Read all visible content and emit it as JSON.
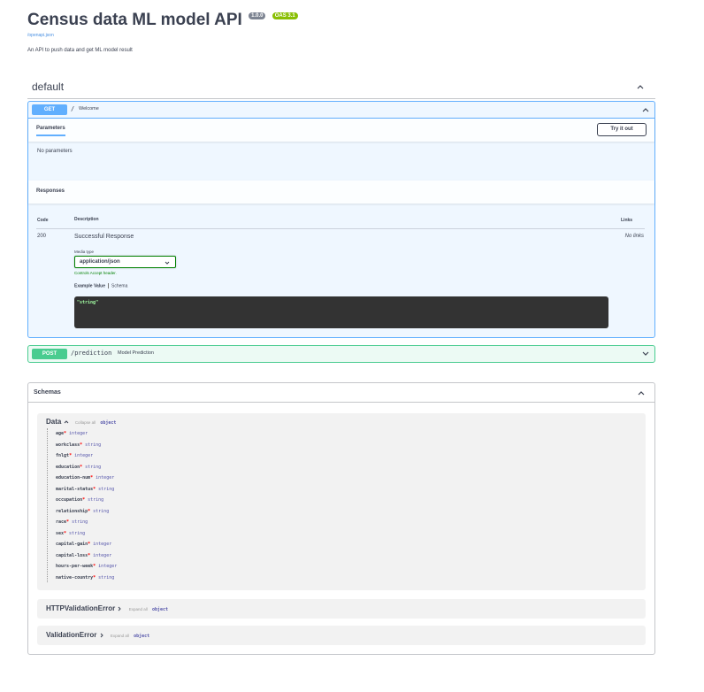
{
  "header": {
    "title": "Census data ML model API",
    "version": "1.0.0",
    "oas": "OAS 3.1",
    "openapi_link": "/openapi.json",
    "description": "An API to push data and get ML model result"
  },
  "tag": {
    "name": "default"
  },
  "get_op": {
    "method": "GET",
    "path": "/",
    "summary": "Welcome",
    "params_tab": "Parameters",
    "try_button": "Try it out",
    "no_params": "No parameters",
    "responses_title": "Responses",
    "col_code": "Code",
    "col_desc": "Description",
    "col_links": "Links",
    "code": "200",
    "resp_desc": "Successful Response",
    "no_links": "No links",
    "media_type_label": "Media type",
    "media_type_value": "application/json",
    "controls_text": "Controls Accept header.",
    "example_value_tab": "Example Value",
    "schema_tab": "Schema",
    "example": "\"string\""
  },
  "post_op": {
    "method": "POST",
    "path": "/prediction",
    "summary": "Model Prediction"
  },
  "schemas": {
    "title": "Schemas",
    "data_model": {
      "name": "Data",
      "toggle": "Collapse all",
      "type": "object",
      "props": [
        {
          "name": "age",
          "type": "integer"
        },
        {
          "name": "workclass",
          "type": "string"
        },
        {
          "name": "fnlgt",
          "type": "integer"
        },
        {
          "name": "education",
          "type": "string"
        },
        {
          "name": "education-num",
          "type": "integer"
        },
        {
          "name": "marital-status",
          "type": "string"
        },
        {
          "name": "occupation",
          "type": "string"
        },
        {
          "name": "relationship",
          "type": "string"
        },
        {
          "name": "race",
          "type": "string"
        },
        {
          "name": "sex",
          "type": "string"
        },
        {
          "name": "capital-gain",
          "type": "integer"
        },
        {
          "name": "capital-loss",
          "type": "integer"
        },
        {
          "name": "hours-per-week",
          "type": "integer"
        },
        {
          "name": "native-country",
          "type": "string"
        }
      ]
    },
    "http_error": {
      "name": "HTTPValidationError",
      "toggle": "Expand all",
      "type": "object"
    },
    "val_error": {
      "name": "ValidationError",
      "toggle": "Expand all",
      "type": "object"
    }
  }
}
